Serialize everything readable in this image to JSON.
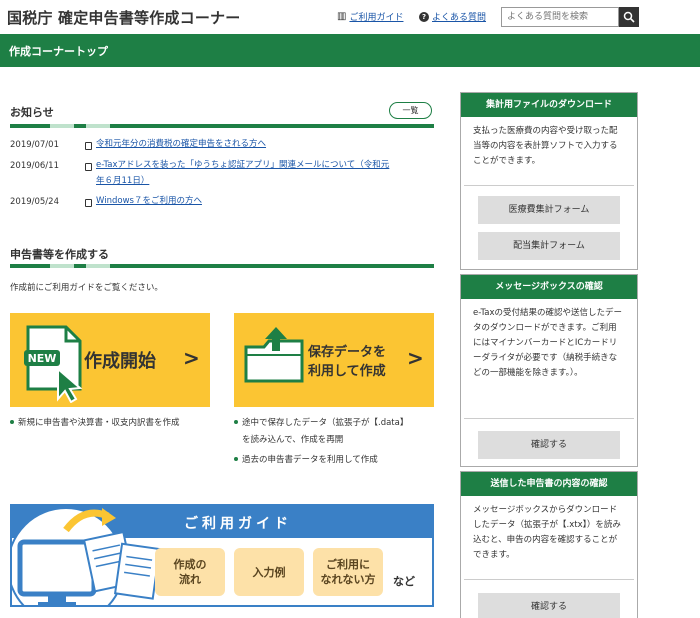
{
  "header": {
    "site_title": "国税庁 確定申告書等作成コーナー",
    "guide_link": "ご利用ガイド",
    "faq_link": "よくある質問",
    "search_placeholder": "よくある質問を検索"
  },
  "page_title": "作成コーナートップ",
  "news": {
    "title": "お知らせ",
    "list_button": "一覧",
    "items": [
      {
        "date": "2019/07/01",
        "line1": "令和元年分の消費税の確定申告をされる方へ",
        "line2": ""
      },
      {
        "date": "2019/06/11",
        "line1": "e-Taxアドレスを装った「ゆうちょ認証アプリ」関連メールについて（令和元",
        "line2": "年６月11日）"
      },
      {
        "date": "2019/05/24",
        "line1": "Windows７をご利用の方へ",
        "line2": ""
      }
    ]
  },
  "create": {
    "title": "申告書等を作成する",
    "note": "作成前にご利用ガイドをご覧ください。",
    "start_card": {
      "badge": "NEW",
      "label": "作成開始"
    },
    "saved_card": {
      "line1": "保存データを",
      "line2": "利用して作成"
    },
    "start_bullets": [
      "新規に申告書や決算書・収支内訳書を作成"
    ],
    "saved_bullets": [
      "途中で保存したデータ（拡張子が【.data】",
      "を読み込んで、作成を再開",
      "過去の申告書データを利用して作成"
    ]
  },
  "guide_banner": {
    "title": "ご利用ガイド",
    "buttons": [
      "作成の\n流れ",
      "入力例",
      "ご利用に\nなれない方"
    ],
    "suffix": "など"
  },
  "sidebar": {
    "download": {
      "title": "集計用ファイルのダウンロード",
      "text": "支払った医療費の内容や受け取った配当等の内容を表計算ソフトで入力することができます。",
      "buttons": [
        "医療費集計フォーム",
        "配当集計フォーム"
      ]
    },
    "messagebox": {
      "title": "メッセージボックスの確認",
      "text": "e-Taxの受付結果の確認や送信したデータのダウンロードができます。ご利用にはマイナンバーカードとICカードリーダライタが必要です（納税手続きなどの一部機能を除きます。）。",
      "button": "確認する"
    },
    "sent": {
      "title": "送信した申告書の内容の確認",
      "text": "メッセージボックスからダウンロードしたデータ（拡張子が【.xtx】）を読み込むと、申告の内容を確認することができます。",
      "button": "確認する"
    }
  },
  "colors": {
    "brand_green": "#1e7f45",
    "card_yellow": "#fbc533",
    "guide_blue": "#3a80c6",
    "link_blue": "#1a55a7"
  }
}
